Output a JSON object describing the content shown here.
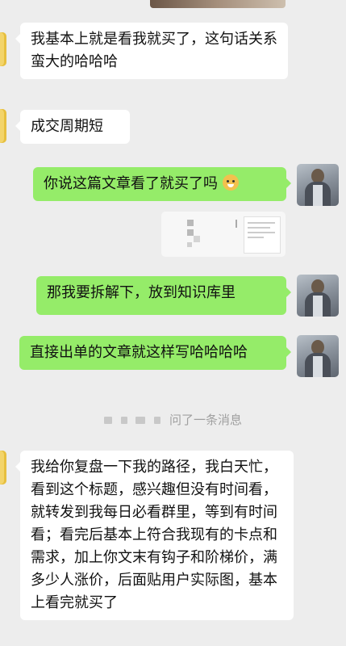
{
  "messages": [
    {
      "side": "left",
      "text": "我基本上就是看我就买了，这句话关系蛮大的哈哈哈"
    },
    {
      "side": "left",
      "text": "成交周期短"
    },
    {
      "side": "right",
      "text": "你说这篇文章看了就买了吗",
      "emoji": "doge-emoji"
    },
    {
      "side": "right",
      "text": "那我要拆解下，放到知识库里"
    },
    {
      "side": "right",
      "text": "直接出单的文章就这样写哈哈哈哈"
    },
    {
      "side": "left",
      "text": "我给你复盘一下我的路径，我白天忙，看到这个标题，感兴趣但没有时间看，就转发到我每日必看群里，等到有时间看；看完后基本上符合我现有的卡点和需求，加上你文末有钩子和阶梯价，满多少人涨价，后面贴用户实际图，基本上看完就买了"
    }
  ],
  "system_notice": {
    "text": "问了一条消息"
  },
  "colors": {
    "background": "#ededed",
    "left_bubble": "#ffffff",
    "right_bubble": "#95ec69"
  }
}
